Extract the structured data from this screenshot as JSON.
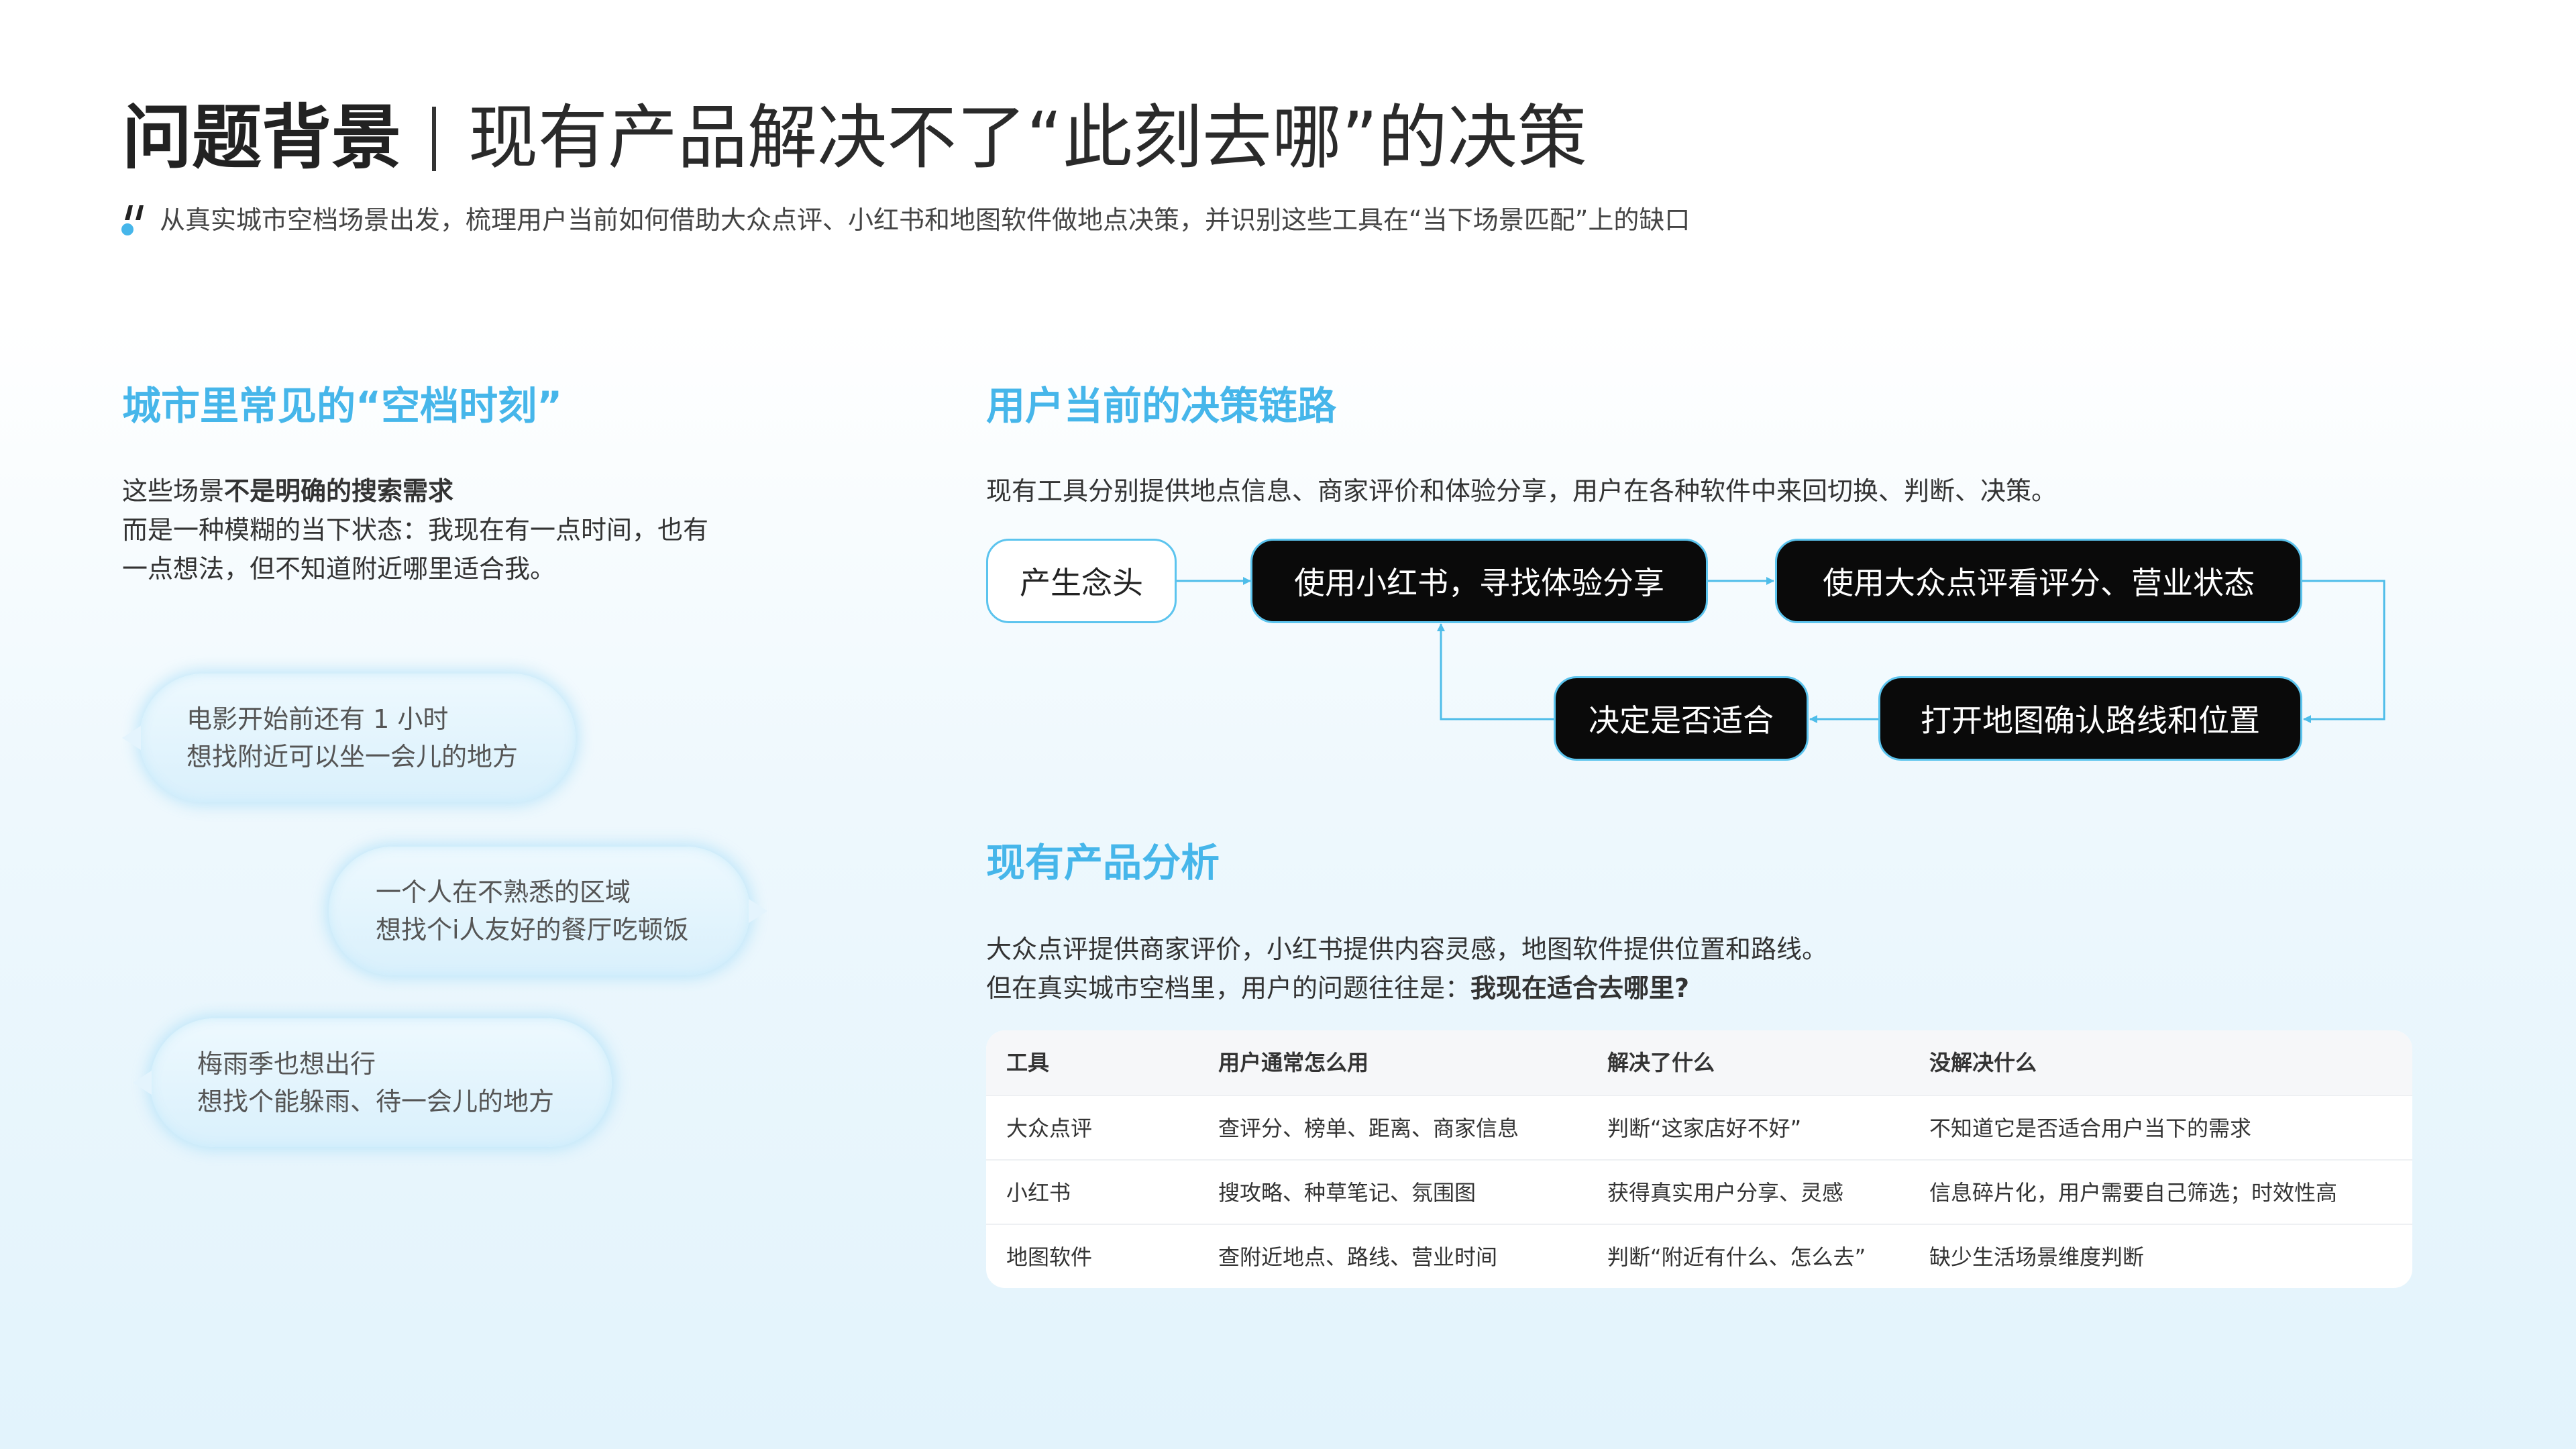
{
  "header": {
    "title_bold": "问题背景",
    "title_rest": "现有产品解决不了“此刻去哪”的决策",
    "subtitle": "从真实城市空档场景出发，梳理用户当前如何借助大众点评、小红书和地图软件做地点决策，并识别这些工具在“当下场景匹配”上的缺口"
  },
  "left": {
    "section_title": "城市里常见的“空档时刻”",
    "intro_line1_prefix": "这些场景",
    "intro_line1_bold": "不是明确的搜索需求",
    "intro_line2": "而是一种模糊的当下状态：我现在有一点时间，也有",
    "intro_line3": "一点想法，但不知道附近哪里适合我。",
    "bubbles": [
      {
        "line1": "电影开始前还有 1 小时",
        "line2": "想找附近可以坐一会儿的地方"
      },
      {
        "line1": "一个人在不熟悉的区域",
        "line2": "想找个i人友好的餐厅吃顿饭"
      },
      {
        "line1": "梅雨季也想出行",
        "line2": "想找个能躲雨、待一会儿的地方"
      }
    ]
  },
  "flow": {
    "section_title": "用户当前的决策链路",
    "desc": "现有工具分别提供地点信息、商家评价和体验分享，用户在各种软件中来回切换、判断、决策。",
    "nodes": {
      "n1": "产生念头",
      "n2": "使用小红书，寻找体验分享",
      "n3": "使用大众点评看评分、营业状态",
      "n4": "打开地图确认路线和位置",
      "n5": "决定是否适合"
    }
  },
  "analysis": {
    "section_title": "现有产品分析",
    "desc_line1": "大众点评提供商家评价，小红书提供内容灵感，地图软件提供位置和路线。",
    "desc_line2_prefix": "但在真实城市空档里，用户的问题往往是：",
    "desc_line2_bold": "我现在适合去哪里?",
    "table": {
      "headers": [
        "工具",
        "用户通常怎么用",
        "解决了什么",
        "没解决什么"
      ],
      "rows": [
        [
          "大众点评",
          "查评分、榜单、距离、商家信息",
          "判断“这家店好不好”",
          "不知道它是否适合用户当下的需求"
        ],
        [
          "小红书",
          "搜攻略、种草笔记、氛围图",
          "获得真实用户分享、灵感",
          "信息碎片化，用户需要自己筛选；时效性高"
        ],
        [
          "地图软件",
          "查附近地点、路线、营业时间",
          "判断“附近有什么、怎么去”",
          "缺少生活场景维度判断"
        ]
      ]
    }
  },
  "colors": {
    "accent": "#46b6ea",
    "node_dark": "#0a0a0a",
    "node_border": "#5cc4ee"
  }
}
